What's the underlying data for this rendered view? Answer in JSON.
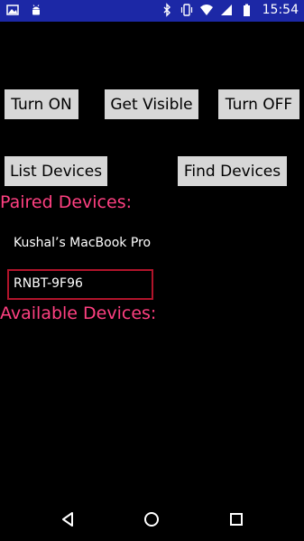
{
  "status_bar": {
    "time": "15:54",
    "icons": [
      "image-icon",
      "android-icon",
      "bluetooth-icon",
      "vibrate-icon",
      "wifi-icon",
      "signal-icon",
      "battery-icon"
    ]
  },
  "buttons": {
    "turn_on": "Turn ON",
    "get_visible": "Get Visible",
    "turn_off": "Turn OFF",
    "list_devices": "List Devices",
    "find_devices": "Find Devices"
  },
  "sections": {
    "paired_title": "Paired Devices:",
    "available_title": "Available Devices:"
  },
  "paired_devices": [
    {
      "name": "Kushal’s MacBook Pro"
    },
    {
      "name": "RNBT-9F96"
    }
  ],
  "colors": {
    "status_bar": "#1c28a6",
    "accent": "#ff4081",
    "selection_border": "#b0142a"
  }
}
